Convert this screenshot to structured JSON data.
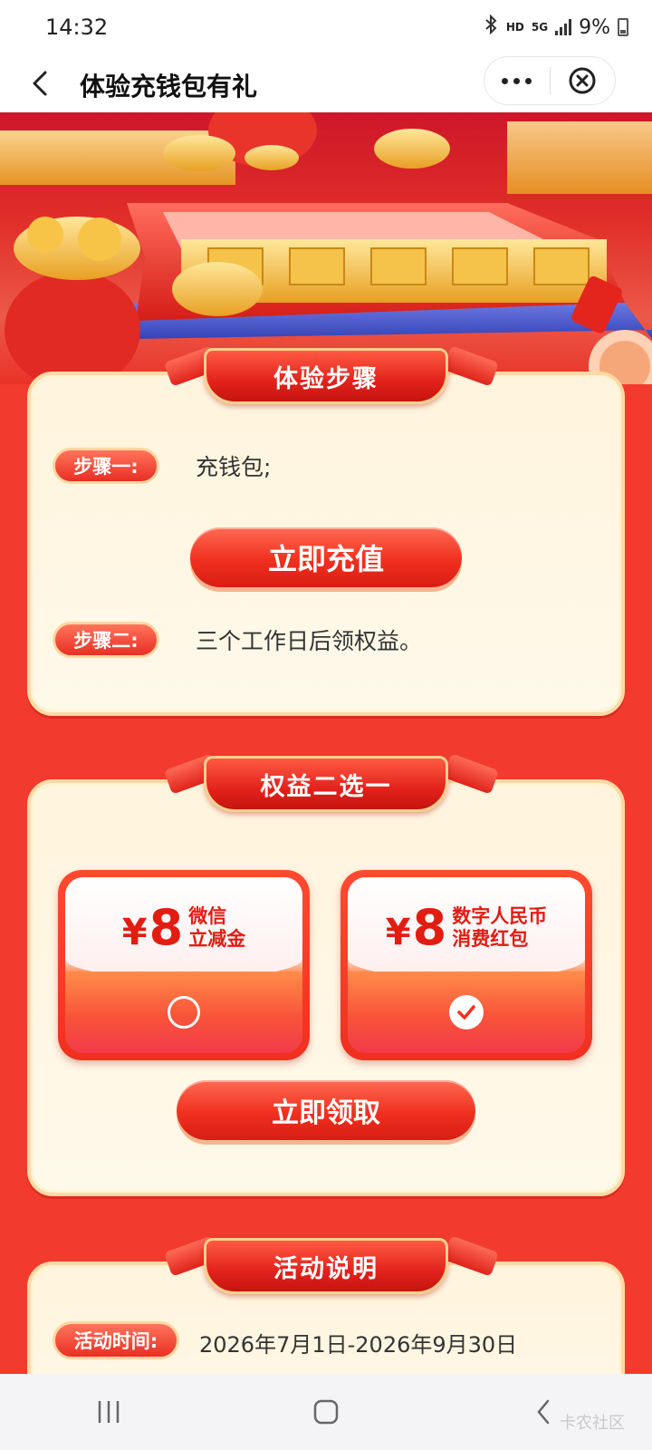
{
  "status_bar": {
    "time": "14:32",
    "network_hd": "HD",
    "network_5g": "5G",
    "battery": "9%"
  },
  "nav": {
    "title": "体验充钱包有礼"
  },
  "steps_card": {
    "title": "体验步骤",
    "step1_label": "步骤一:",
    "step1_text": "充钱包;",
    "recharge_button": "立即充值",
    "step2_label": "步骤二:",
    "step2_text": "三个工作日后领权益。"
  },
  "benefits_card": {
    "title": "权益二选一",
    "options": [
      {
        "currency": "¥",
        "amount": "8",
        "line1": "微信",
        "line2": "立减金",
        "selected": false
      },
      {
        "currency": "¥",
        "amount": "8",
        "line1": "数字人民币",
        "line2": "消费红包",
        "selected": true
      }
    ],
    "claim_button": "立即领取"
  },
  "activity_card": {
    "title": "活动说明",
    "time_label": "活动时间:",
    "time_value": "2026年7月1日-2026年9月30日"
  },
  "watermark": "卡农社区",
  "colors": {
    "page_bg": "#f23a2e",
    "accent_red": "#e11d12",
    "card_bg": "#fff4dd",
    "gold_border": "#ffd9a3"
  }
}
